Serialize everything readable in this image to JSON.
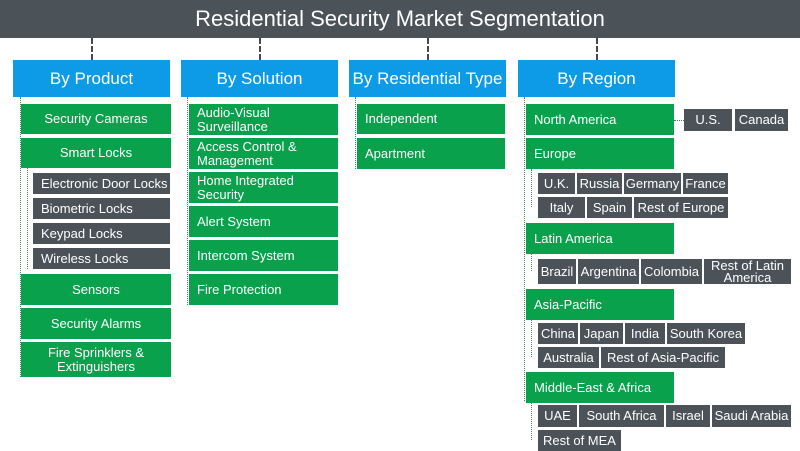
{
  "title": "Residential Security Market Segmentation",
  "colors": {
    "title_bg": "#4b5359",
    "category_bg": "#0d9ae6",
    "segment_bg": "#0aa14d",
    "subsegment_bg": "#4b5359"
  },
  "product": {
    "header": "By Product",
    "items": [
      "Security Cameras",
      "Smart Locks",
      "Sensors",
      "Security Alarms",
      "Fire Sprinklers & Extinguishers"
    ],
    "smart_locks": [
      "Electronic Door Locks",
      "Biometric Locks",
      "Keypad Locks",
      "Wireless Locks"
    ]
  },
  "solution": {
    "header": "By Solution",
    "items": [
      "Audio-Visual Surveillance",
      "Access Control & Management",
      "Home Integrated Security",
      "Alert System",
      "Intercom System",
      "Fire Protection"
    ]
  },
  "residential": {
    "header": "By Residential Type",
    "items": [
      "Independent",
      "Apartment"
    ]
  },
  "region": {
    "header": "By Region",
    "north_america": {
      "label": "North America",
      "countries": [
        "U.S.",
        "Canada"
      ]
    },
    "europe": {
      "label": "Europe",
      "countries": [
        "U.K.",
        "Russia",
        "Germany",
        "France",
        "Italy",
        "Spain",
        "Rest of Europe"
      ]
    },
    "latin_america": {
      "label": "Latin America",
      "countries": [
        "Brazil",
        "Argentina",
        "Colombia",
        "Rest of Latin America"
      ]
    },
    "asia_pacific": {
      "label": "Asia-Pacific",
      "countries": [
        "China",
        "Japan",
        "India",
        "South Korea",
        "Australia",
        "Rest of Asia-Pacific"
      ]
    },
    "mea": {
      "label": "Middle-East & Africa",
      "countries": [
        "UAE",
        "South Africa",
        "Israel",
        "Saudi Arabia",
        "Rest of MEA"
      ]
    }
  }
}
